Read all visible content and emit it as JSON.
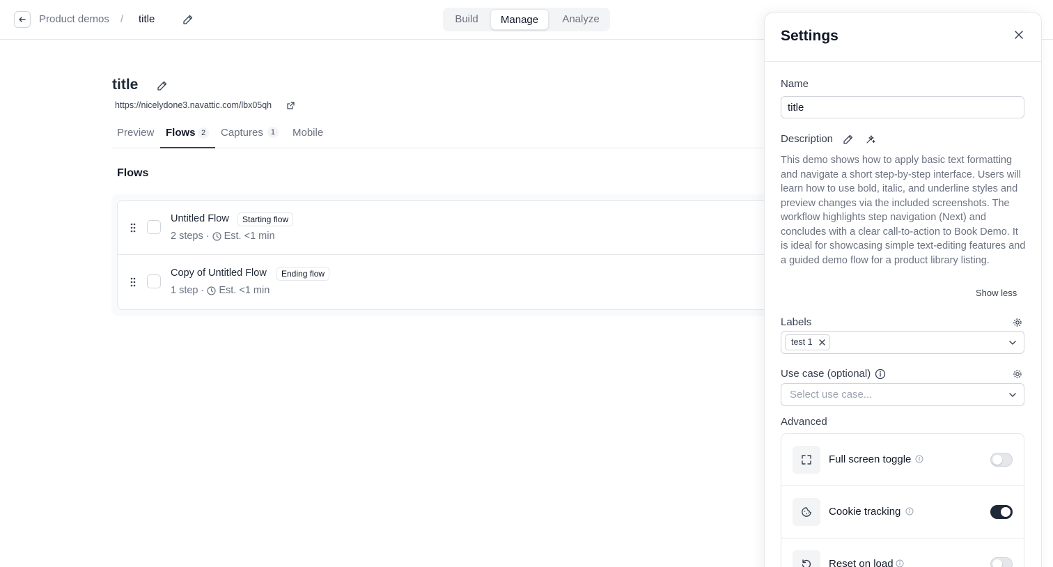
{
  "header": {
    "breadcrumb_parent": "Product demos",
    "breadcrumb_separator": "/",
    "breadcrumb_current": "title",
    "modes": [
      "Build",
      "Manage",
      "Analyze"
    ],
    "active_mode": "Manage"
  },
  "demo": {
    "title": "title",
    "url": "https://nicelydone3.navattic.com/lbx05qh"
  },
  "tabs": [
    {
      "label": "Preview",
      "count": null
    },
    {
      "label": "Flows",
      "count": "2"
    },
    {
      "label": "Captures",
      "count": "1"
    },
    {
      "label": "Mobile",
      "count": null
    }
  ],
  "active_tab": "Flows",
  "flows_section": {
    "heading": "Flows",
    "items": [
      {
        "name": "Untitled Flow",
        "badge": "Starting flow",
        "steps": "2 steps",
        "separator": "·",
        "estimate": "Est. <1 min"
      },
      {
        "name": "Copy of Untitled Flow",
        "badge": "Ending flow",
        "steps": "1 step",
        "separator": "·",
        "estimate": "Est. <1 min"
      }
    ]
  },
  "settings": {
    "title": "Settings",
    "name_label": "Name",
    "name_value": "title",
    "description_label": "Description",
    "description_text": "This demo shows how to apply basic text formatting and navigate a short step-by-step interface. Users will learn how to use bold, italic, and underline styles and preview changes via the included screenshots. The workflow highlights step navigation (Next) and concludes with a clear call-to-action to Book Demo. It is ideal for showcasing simple text-editing features and a guided demo flow for a product library listing.",
    "show_less": "Show less",
    "labels_label": "Labels",
    "labels_selected": [
      "test 1"
    ],
    "use_case_label": "Use case (optional)",
    "use_case_placeholder": "Select use case...",
    "advanced_label": "Advanced",
    "advanced_items": [
      {
        "label": "Full screen toggle",
        "icon": "fullscreen-icon",
        "enabled": false
      },
      {
        "label": "Cookie tracking",
        "icon": "cookie-icon",
        "enabled": true
      },
      {
        "label": "Reset on load",
        "icon": "reset-icon",
        "enabled": false
      }
    ]
  },
  "colors": {
    "toggle_on": "#1f2937",
    "border": "#e5e7eb",
    "muted_text": "#6b7280"
  }
}
